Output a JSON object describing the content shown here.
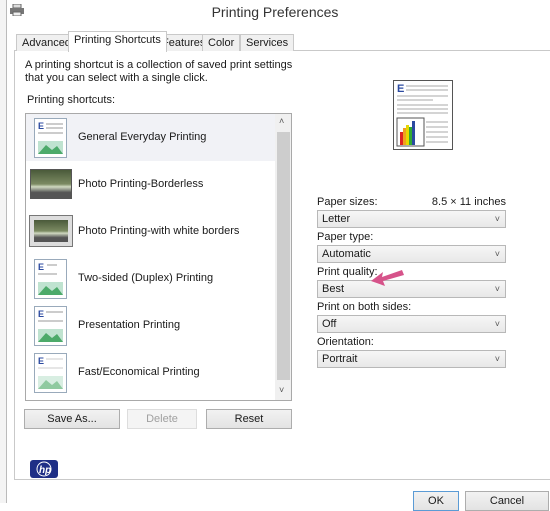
{
  "window": {
    "title": "Printing Preferences",
    "icon": "printer-icon"
  },
  "tabs": [
    {
      "label": "Advanced"
    },
    {
      "label": "Printing Shortcuts",
      "active": true
    },
    {
      "label": "Features"
    },
    {
      "label": "Color"
    },
    {
      "label": "Services"
    }
  ],
  "description": "A printing shortcut is a collection of saved print settings that you can select with a single click.",
  "shortcuts_label": "Printing shortcuts:",
  "shortcuts": [
    {
      "label": "General Everyday Printing",
      "icon": "document-icon",
      "selected": true
    },
    {
      "label": "Photo Printing-Borderless",
      "icon": "photo-icon"
    },
    {
      "label": "Photo Printing-with white borders",
      "icon": "photo-bordered-icon"
    },
    {
      "label": "Two-sided (Duplex) Printing",
      "icon": "duplex-icon"
    },
    {
      "label": "Presentation Printing",
      "icon": "document-icon"
    },
    {
      "label": "Fast/Economical Printing",
      "icon": "document-icon"
    }
  ],
  "buttons": {
    "save_as": "Save As...",
    "delete": "Delete",
    "reset": "Reset",
    "ok": "OK",
    "cancel": "Cancel"
  },
  "settings": {
    "paper_sizes": {
      "label": "Paper sizes:",
      "dimension": "8.5 × 11 inches",
      "value": "Letter"
    },
    "paper_type": {
      "label": "Paper type:",
      "value": "Automatic"
    },
    "print_quality": {
      "label": "Print quality:",
      "value": "Best"
    },
    "both_sides": {
      "label": "Print on both sides:",
      "value": "Off"
    },
    "orientation": {
      "label": "Orientation:",
      "value": "Portrait"
    }
  },
  "colors": {
    "annotation_arrow": "#d6538a",
    "hp_logo": "#1f2f86"
  }
}
